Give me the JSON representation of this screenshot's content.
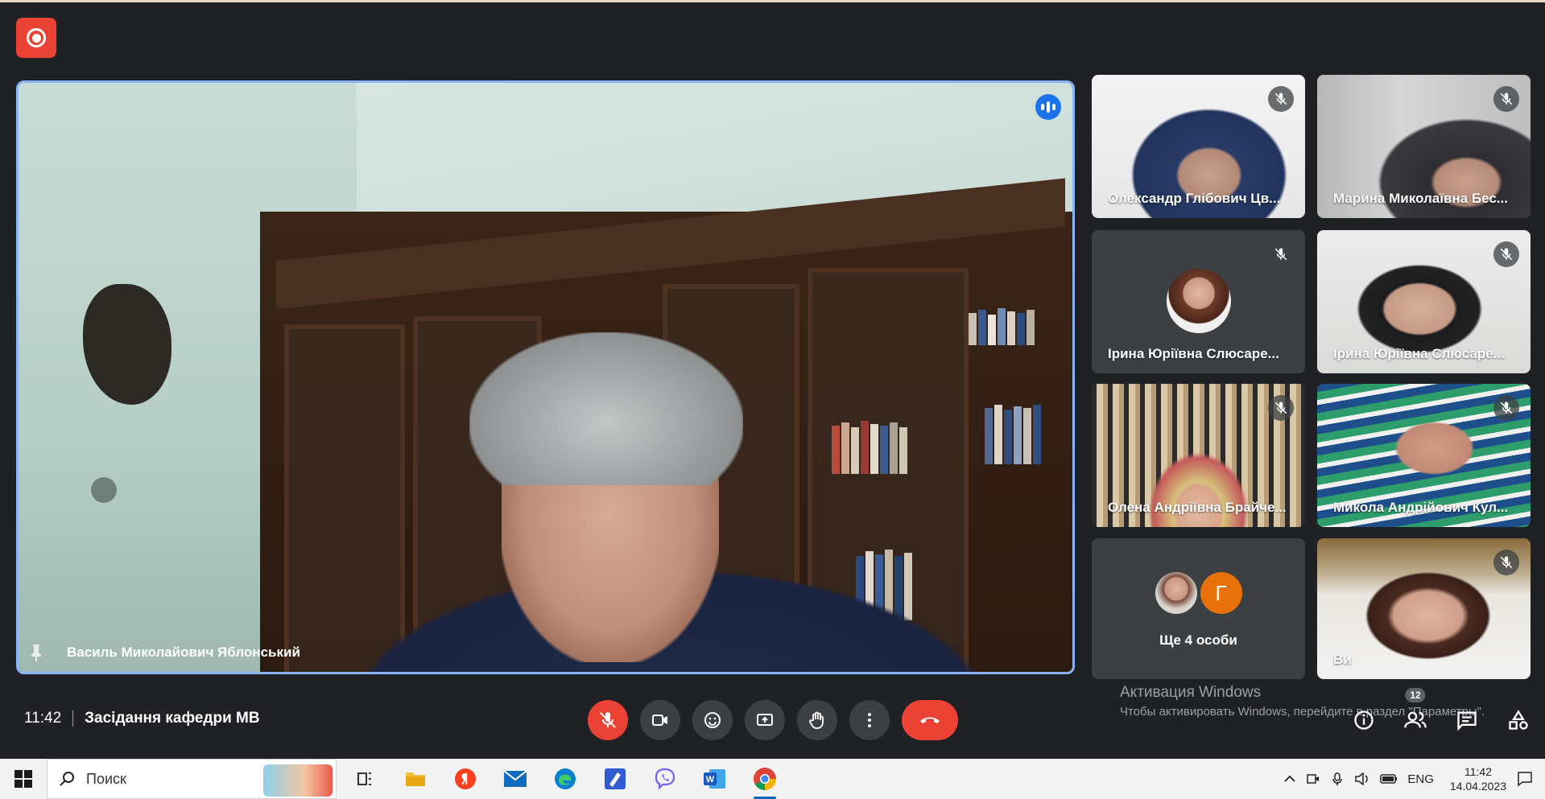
{
  "meeting": {
    "time": "11:42",
    "title": "Засідання кафедри МВ"
  },
  "main_speaker": {
    "name": "Василь Миколайович Яблонський"
  },
  "participants": [
    {
      "name": "Олександр Глібович Цв..."
    },
    {
      "name": "Марина Миколаївна Бес..."
    },
    {
      "name": "Ірина Юріївна Слюсаре..."
    },
    {
      "name": "Ірина Юріївна Слюсаре..."
    },
    {
      "name": "Олена Андріївна Брайче..."
    },
    {
      "name": "Микола Андрійович Кул..."
    },
    {
      "more_label": "Ще 4 особи",
      "initial": "Г"
    },
    {
      "name": "Ви"
    }
  ],
  "people_count": "12",
  "activation": {
    "line1": "Активация Windows",
    "line2": "Чтобы активировать Windows, перейдите в раздел \"Параметры\"."
  },
  "taskbar": {
    "search_placeholder": "Поиск",
    "lang": "ENG",
    "clock_time": "11:42",
    "clock_date": "14.04.2023"
  },
  "colors": {
    "accent": "#8ab4f8",
    "danger": "#ea4335",
    "background": "#202124",
    "tile": "#3c4043"
  }
}
